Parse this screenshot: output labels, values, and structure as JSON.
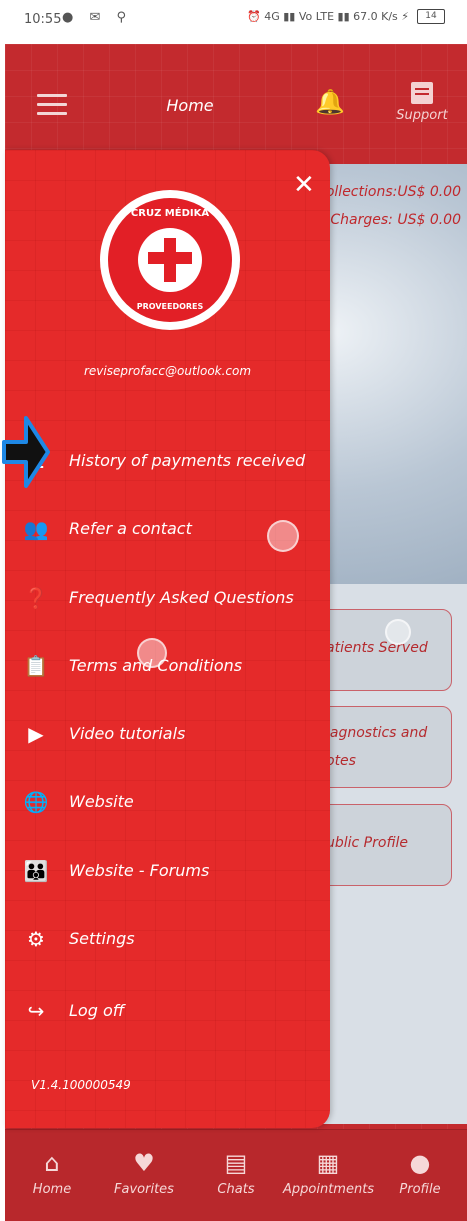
{
  "status_bar": {
    "time": "10:55",
    "notification_icons": "● ✉ ⚲",
    "right_indicators": "⏰ 4G ▮▮ Vo LTE ▮▮ 67.0 K/s ⚡",
    "battery": "14"
  },
  "header": {
    "title": "Home",
    "support_label": "Support"
  },
  "background": {
    "collections_line1": "-collections:US$ 0.00",
    "collections_line2": "r Charges: US$ 0.00",
    "card_patients": "atients Served",
    "card_diagnostics_line1": "iagnostics and",
    "card_diagnostics_line2": "otes",
    "card_profile": "ublic Profile"
  },
  "drawer": {
    "logo_top_text": "CRUZ MÉDIKA",
    "logo_bottom_text": "PROVEEDORES",
    "email": "reviseprofacc@outlook.com",
    "menu": [
      {
        "label": "History of payments received",
        "icon": "receipt-icon"
      },
      {
        "label": "Refer a contact",
        "icon": "people-icon"
      },
      {
        "label": "Frequently Asked Questions",
        "icon": "question-circle-icon"
      },
      {
        "label": "Terms and Conditions",
        "icon": "clipboard-icon"
      },
      {
        "label": "Video tutorials",
        "icon": "youtube-icon"
      },
      {
        "label": "Website",
        "icon": "globe-icon"
      },
      {
        "label": "Website - Forums",
        "icon": "group-icon"
      },
      {
        "label": "Settings",
        "icon": "gear-icon"
      },
      {
        "label": "Log off",
        "icon": "logout-icon"
      }
    ],
    "version": "V1.4.100000549"
  },
  "bottom_nav": [
    {
      "label": "Home",
      "icon": "home-icon"
    },
    {
      "label": "Favorites",
      "icon": "heart-icon"
    },
    {
      "label": "Chats",
      "icon": "chat-icon"
    },
    {
      "label": "Appointments",
      "icon": "calendar-icon"
    },
    {
      "label": "Profile",
      "icon": "user-icon"
    }
  ],
  "colors": {
    "brand_red": "#e52a2a",
    "dark_red": "#c32a2e",
    "arrow_blue": "#1e88e5"
  }
}
